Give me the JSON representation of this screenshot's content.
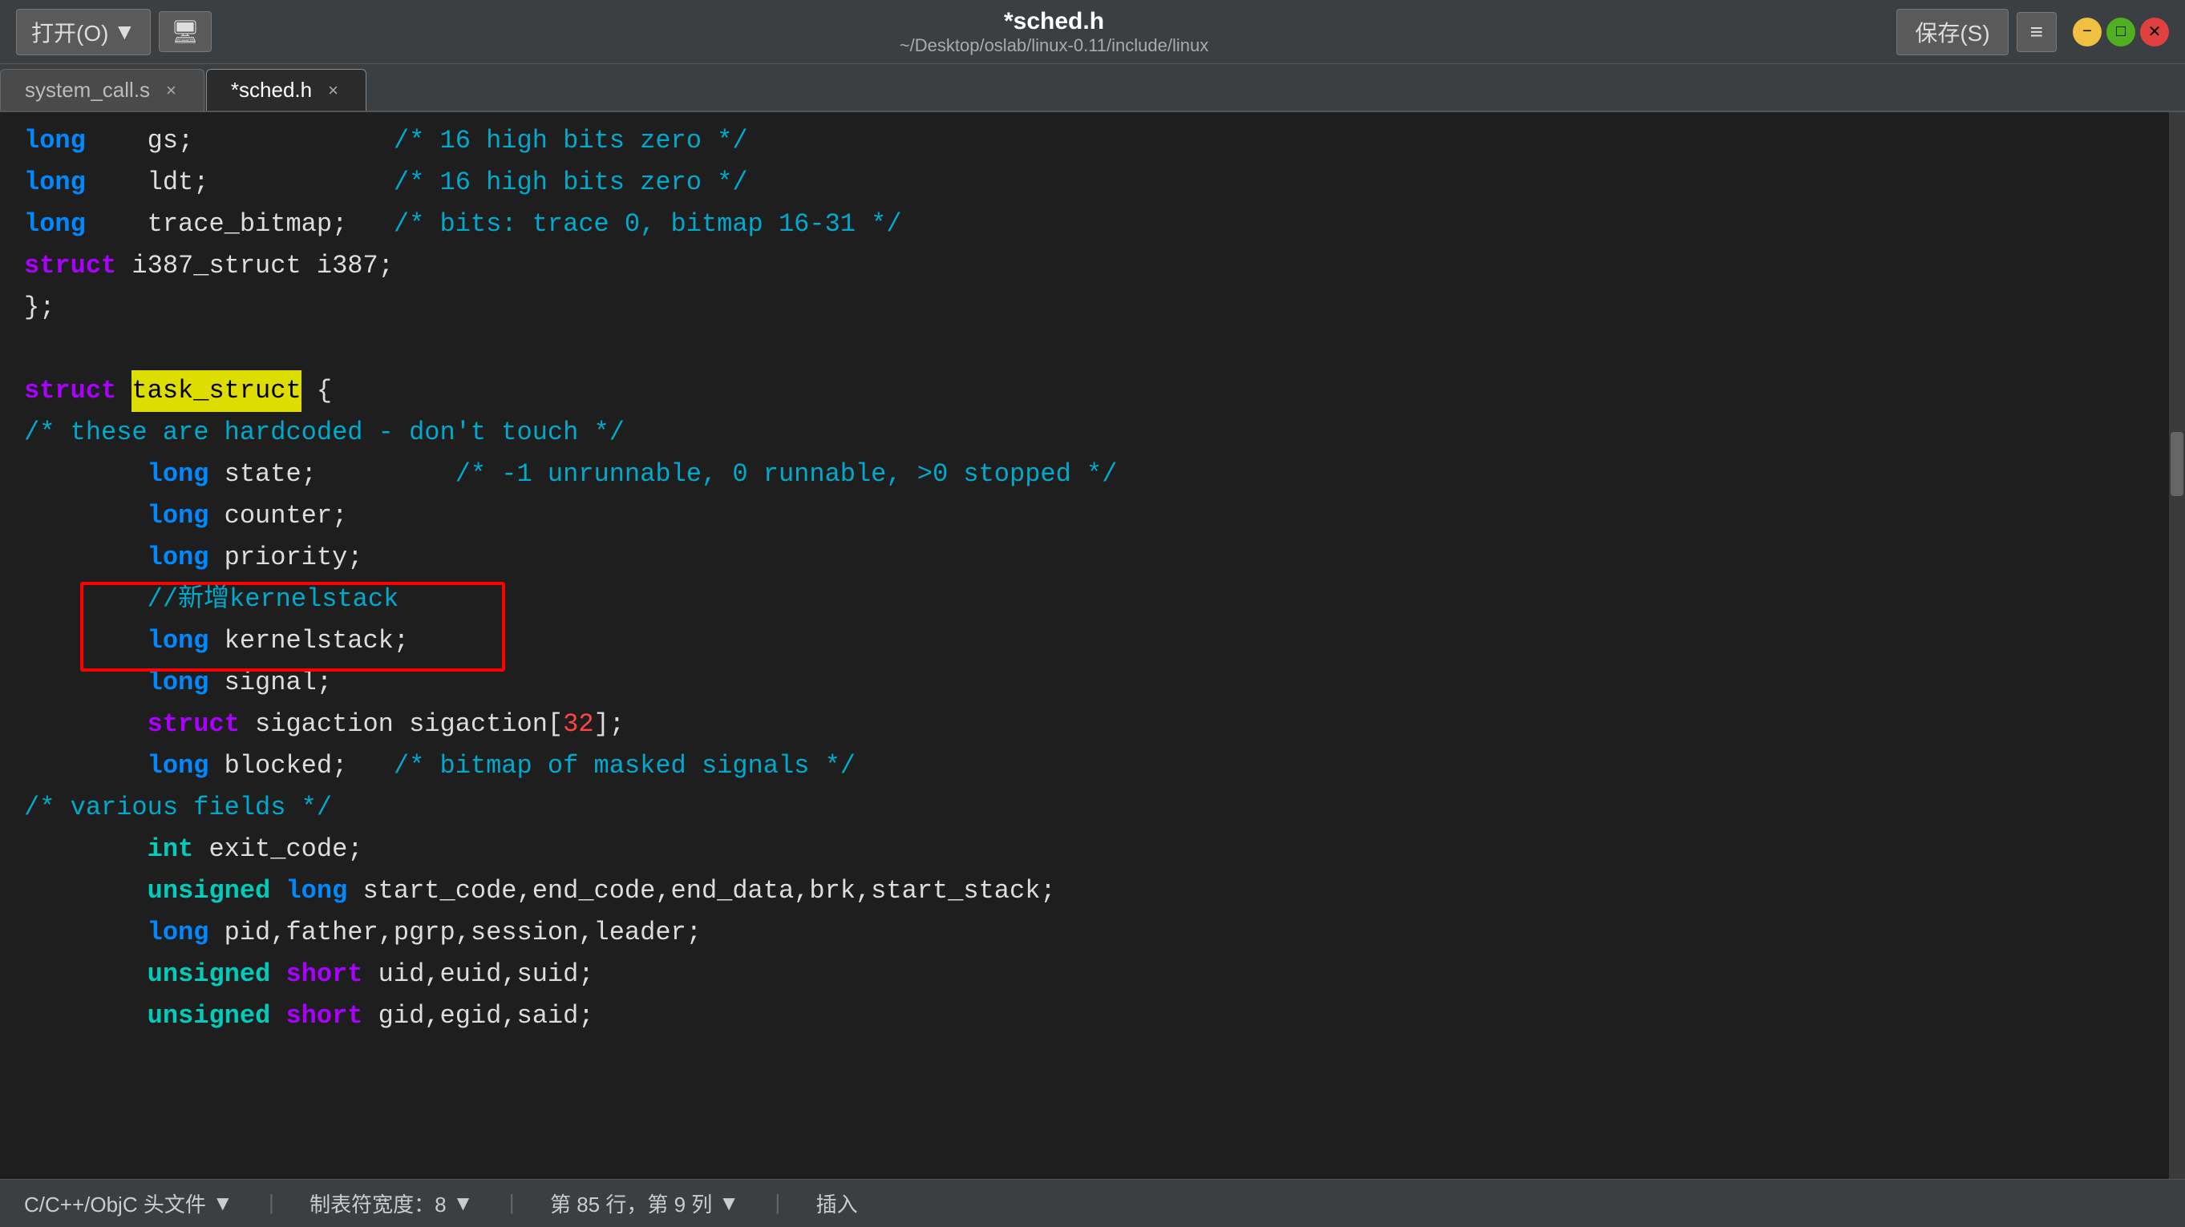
{
  "titlebar": {
    "open_label": "打开(O)",
    "open_dropdown": "▼",
    "filename": "*sched.h",
    "filepath": "~/Desktop/oslab/linux-0.11/include/linux",
    "save_label": "保存(S)",
    "menu_icon": "≡"
  },
  "tabs": [
    {
      "label": "system_call.s",
      "active": false
    },
    {
      "label": "*sched.h",
      "active": true
    }
  ],
  "code_lines": [
    {
      "indent": "        ",
      "content": "long    gs;             /* 16 high bits zero */",
      "type": "mixed"
    },
    {
      "indent": "        ",
      "content": "long    ldt;            /* 16 high bits zero */",
      "type": "mixed"
    },
    {
      "indent": "        ",
      "content": "long    trace_bitmap;   /* bits: trace 0, bitmap 16-31 */",
      "type": "mixed"
    },
    {
      "indent": "        ",
      "content": "struct i387_struct i387;",
      "type": "mixed"
    },
    {
      "indent": "",
      "content": "};",
      "type": "plain"
    },
    {
      "indent": "",
      "content": "",
      "type": "empty"
    },
    {
      "indent": "",
      "content": "struct task_struct {",
      "type": "struct_line"
    },
    {
      "indent": "",
      "content": "/* these are hardcoded - don't touch */",
      "type": "comment_line"
    },
    {
      "indent": "        ",
      "content": "long state;         /* -1 unrunnable, 0 runnable, >0 stopped */",
      "type": "mixed"
    },
    {
      "indent": "        ",
      "content": "long counter;",
      "type": "long_line"
    },
    {
      "indent": "        ",
      "content": "long priority;",
      "type": "long_line"
    },
    {
      "indent": "        ",
      "content": "//新增kernelstack",
      "type": "comment_cn"
    },
    {
      "indent": "        ",
      "content": "long kernelstack;",
      "type": "long_line_redbox"
    },
    {
      "indent": "        ",
      "content": "long signal;",
      "type": "long_line"
    },
    {
      "indent": "        ",
      "content": "struct sigaction sigaction[32];",
      "type": "struct_sig"
    },
    {
      "indent": "        ",
      "content": "long blocked;   /* bitmap of masked signals */",
      "type": "mixed"
    },
    {
      "indent": "",
      "content": "/* various fields */",
      "type": "comment_various"
    },
    {
      "indent": "        ",
      "content": "int exit_code;",
      "type": "int_line"
    },
    {
      "indent": "        ",
      "content": "unsigned long start_code,end_code,end_data,brk,start_stack;",
      "type": "unsigned_line"
    },
    {
      "indent": "        ",
      "content": "long pid,father,pgrp,session,leader;",
      "type": "long_line"
    },
    {
      "indent": "        ",
      "content": "unsigned short uid,euid,suid;",
      "type": "unsigned_short"
    },
    {
      "indent": "        ",
      "content": "unsigned short gid,egid,said;",
      "type": "unsigned_short"
    }
  ],
  "statusbar": {
    "lang": "C/C++/ObjC 头文件",
    "lang_dropdown": "▼",
    "tab_label": "制表符宽度：8",
    "tab_dropdown": "▼",
    "position": "第 85 行，第 9 列",
    "pos_dropdown": "▼",
    "mode": "插入"
  }
}
